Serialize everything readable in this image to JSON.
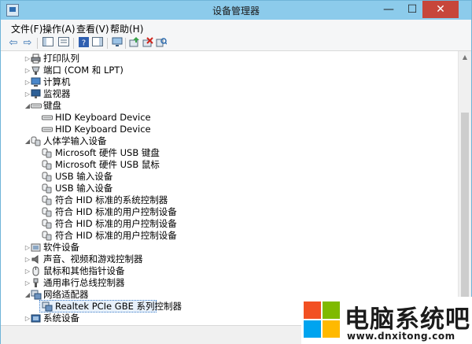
{
  "window": {
    "title": "设备管理器",
    "controls": {
      "minimize": "—",
      "maximize": "☐",
      "close": "✕"
    }
  },
  "menu": [
    "文件(F)",
    "操作(A)",
    "查看(V)",
    "帮助(H)"
  ],
  "toolbar": [
    "back-icon",
    "forward-icon",
    "show-hide-console-tree-icon",
    "properties-icon",
    "help-icon",
    "show-action-pane-icon",
    "computer-icon",
    "update-driver-icon",
    "uninstall-icon",
    "scan-hardware-icon"
  ],
  "tree": [
    {
      "label": "打印队列",
      "expander": "collapsed",
      "icon": "printer-icon"
    },
    {
      "label": "端口 (COM 和 LPT)",
      "expander": "collapsed",
      "icon": "port-icon"
    },
    {
      "label": "计算机",
      "expander": "collapsed",
      "icon": "computer-icon"
    },
    {
      "label": "监视器",
      "expander": "collapsed",
      "icon": "monitor-icon"
    },
    {
      "label": "键盘",
      "expander": "expanded",
      "icon": "keyboard-icon"
    },
    {
      "label": "HID Keyboard Device",
      "expander": "none",
      "icon": "keyboard-icon"
    },
    {
      "label": "HID Keyboard Device",
      "expander": "none",
      "icon": "keyboard-icon"
    },
    {
      "label": "人体学输入设备",
      "expander": "expanded",
      "icon": "hid-icon"
    },
    {
      "label": "Microsoft 硬件 USB 键盘",
      "expander": "none",
      "icon": "hid-icon"
    },
    {
      "label": "Microsoft 硬件 USB 鼠标",
      "expander": "none",
      "icon": "hid-icon"
    },
    {
      "label": "USB 输入设备",
      "expander": "none",
      "icon": "hid-icon"
    },
    {
      "label": "USB 输入设备",
      "expander": "none",
      "icon": "hid-icon"
    },
    {
      "label": "符合 HID 标准的系统控制器",
      "expander": "none",
      "icon": "hid-icon"
    },
    {
      "label": "符合 HID 标准的用户控制设备",
      "expander": "none",
      "icon": "hid-icon"
    },
    {
      "label": "符合 HID 标准的用户控制设备",
      "expander": "none",
      "icon": "hid-icon"
    },
    {
      "label": "符合 HID 标准的用户控制设备",
      "expander": "none",
      "icon": "hid-icon"
    },
    {
      "label": "软件设备",
      "expander": "collapsed",
      "icon": "software-device-icon"
    },
    {
      "label": "声音、视频和游戏控制器",
      "expander": "collapsed",
      "icon": "speaker-icon"
    },
    {
      "label": "鼠标和其他指针设备",
      "expander": "collapsed",
      "icon": "mouse-icon"
    },
    {
      "label": "通用串行总线控制器",
      "expander": "collapsed",
      "icon": "usb-icon"
    },
    {
      "label": "网络适配器",
      "expander": "expanded",
      "icon": "network-icon"
    },
    {
      "label": "Realtek PCIe GBE 系列控制器",
      "expander": "none",
      "icon": "network-icon",
      "selected": true
    },
    {
      "label": "系统设备",
      "expander": "collapsed",
      "icon": "system-device-icon"
    }
  ],
  "watermark": {
    "text": "电脑系统吧",
    "url": "www.dnxitong.com",
    "colors": [
      "#f25022",
      "#7fba00",
      "#00a4ef",
      "#ffb900"
    ]
  }
}
